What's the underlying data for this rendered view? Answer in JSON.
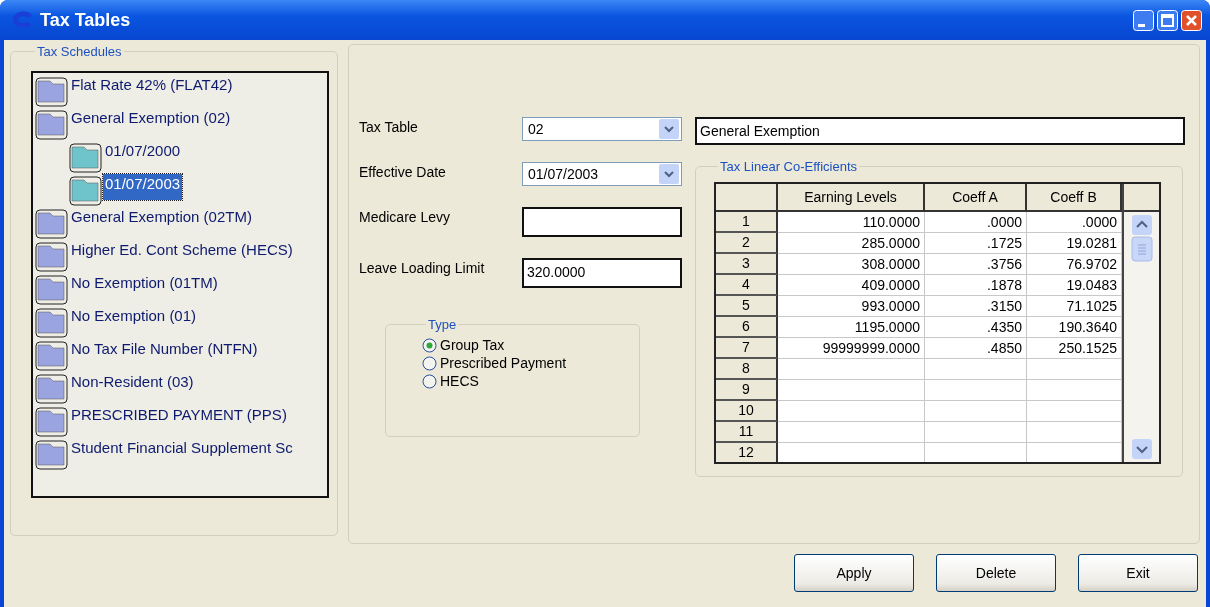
{
  "window": {
    "title": "Tax Tables"
  },
  "schedules": {
    "title": "Tax Schedules",
    "items": [
      {
        "label": "Flat Rate 42% (FLAT42)",
        "selected": false
      },
      {
        "label": "General Exemption (02)",
        "selected": false,
        "children": [
          {
            "label": "01/07/2000",
            "selected": false
          },
          {
            "label": "01/07/2003",
            "selected": true
          }
        ]
      },
      {
        "label": "General Exemption (02TM)",
        "selected": false
      },
      {
        "label": "Higher Ed. Cont Scheme (HECS)",
        "selected": false
      },
      {
        "label": "No Exemption (01TM)",
        "selected": false
      },
      {
        "label": "No Exemption (01)",
        "selected": false
      },
      {
        "label": "No Tax File Number (NTFN)",
        "selected": false
      },
      {
        "label": "Non-Resident (03)",
        "selected": false
      },
      {
        "label": "PRESCRIBED PAYMENT (PPS)",
        "selected": false
      },
      {
        "label": "Student Financial Supplement Sc",
        "selected": false
      }
    ]
  },
  "form": {
    "tax_table": {
      "label": "Tax Table",
      "value": "02",
      "description": "General Exemption"
    },
    "effective_date": {
      "label": "Effective Date",
      "value": "01/07/2003"
    },
    "medicare_levy": {
      "label": "Medicare Levy"
    },
    "leave_loading_limit": {
      "label": "Leave Loading Limit",
      "value": "320.0000"
    },
    "type": {
      "title": "Type",
      "options": [
        {
          "label": "Group Tax",
          "selected": true
        },
        {
          "label": "Prescribed Payment",
          "selected": false
        },
        {
          "label": "HECS",
          "selected": false
        }
      ]
    }
  },
  "coefficients": {
    "title": "Tax Linear Co-Efficients",
    "columns": [
      "Earning Levels",
      "Coeff A",
      "Coeff B"
    ],
    "rows": [
      {
        "number": "1",
        "cells": [
          "110.0000",
          ".0000",
          ".0000"
        ]
      },
      {
        "number": "2",
        "cells": [
          "285.0000",
          ".1725",
          "19.0281"
        ]
      },
      {
        "number": "3",
        "cells": [
          "308.0000",
          ".3756",
          "76.9702"
        ]
      },
      {
        "number": "4",
        "cells": [
          "409.0000",
          ".1878",
          "19.0483"
        ]
      },
      {
        "number": "5",
        "cells": [
          "993.0000",
          ".3150",
          "71.1025"
        ]
      },
      {
        "number": "6",
        "cells": [
          "1195.0000",
          ".4350",
          "190.3640"
        ]
      },
      {
        "number": "7",
        "cells": [
          "99999999.0000",
          ".4850",
          "250.1525"
        ]
      },
      {
        "number": "8"
      },
      {
        "number": "9"
      },
      {
        "number": "10"
      },
      {
        "number": "11"
      },
      {
        "number": "12"
      }
    ]
  },
  "buttons": [
    "Apply",
    "Delete",
    "Exit"
  ]
}
